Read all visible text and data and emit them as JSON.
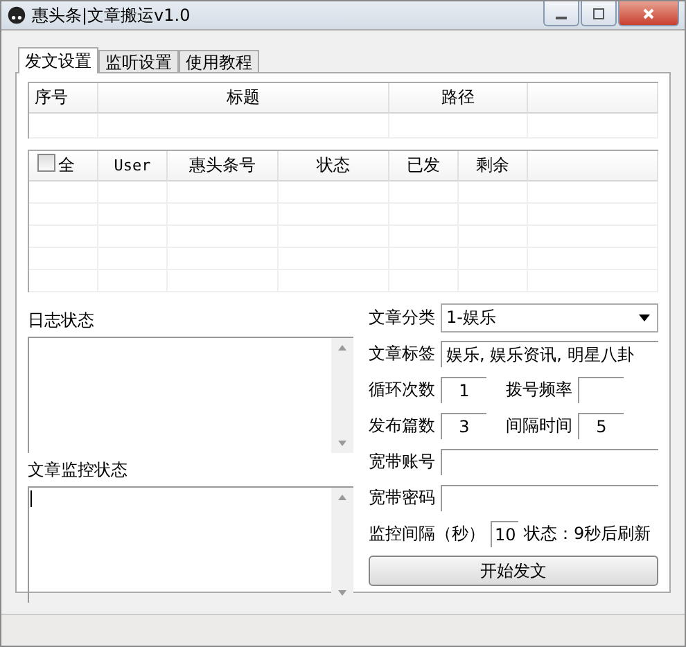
{
  "window": {
    "title": "惠头条|文章搬运v1.0"
  },
  "tabs": [
    {
      "label": "发文设置",
      "selected": true
    },
    {
      "label": "监听设置",
      "selected": false
    },
    {
      "label": "使用教程",
      "selected": false
    }
  ],
  "articles_table": {
    "columns": [
      "序号",
      "标题",
      "路径"
    ]
  },
  "accounts_table": {
    "select_all": {
      "label": "全",
      "checked": false
    },
    "columns": [
      "User",
      "惠头条号",
      "状态",
      "已发",
      "剩余"
    ]
  },
  "log": {
    "label": "日志状态"
  },
  "monitor_log": {
    "label": "文章监控状态"
  },
  "form": {
    "category": {
      "label": "文章分类",
      "value": "1-娱乐"
    },
    "tags": {
      "label": "文章标签",
      "value": "娱乐, 娱乐资讯, 明星八卦"
    },
    "loops": {
      "label": "循环次数",
      "value": "1"
    },
    "dial_rate": {
      "label": "拨号频率"
    },
    "post_count": {
      "label": "发布篇数",
      "value": "3"
    },
    "interval": {
      "label": "间隔时间",
      "value": "5"
    },
    "broadband_account": {
      "label": "宽带账号"
    },
    "broadband_password": {
      "label": "宽带密码"
    },
    "monitor_interval": {
      "label": "监控间隔（秒）",
      "value": "10"
    },
    "status": "状态：9秒后刷新"
  },
  "start_button": "开始发文"
}
